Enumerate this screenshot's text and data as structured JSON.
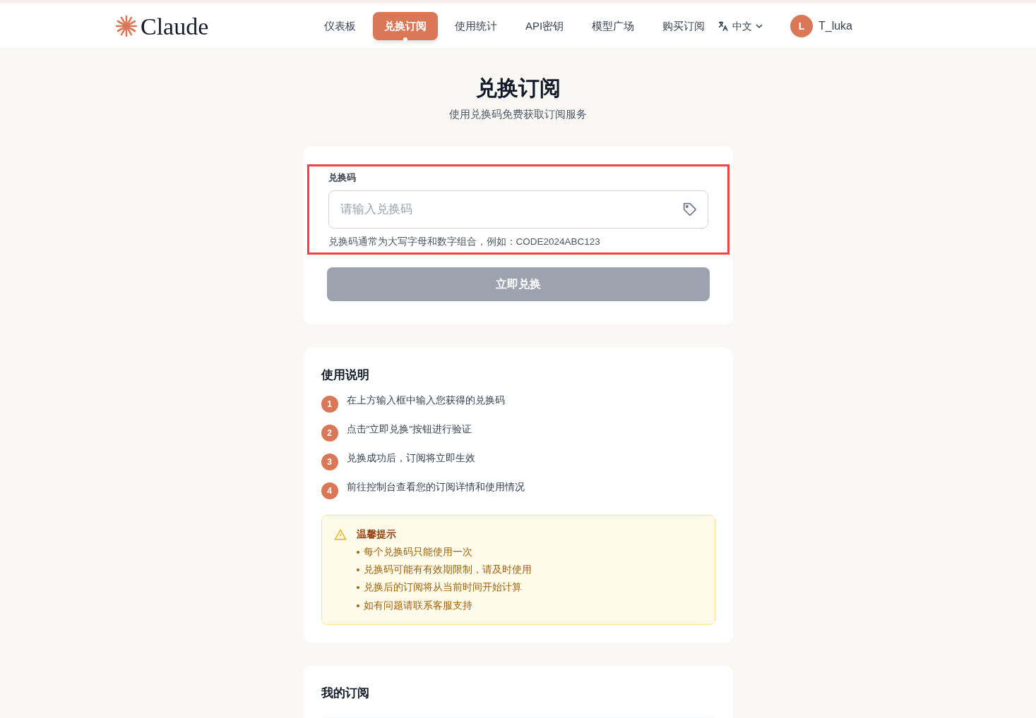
{
  "header": {
    "logo": "Claude",
    "nav": [
      {
        "label": "仪表板",
        "selected": false
      },
      {
        "label": "兑换订阅",
        "selected": true
      },
      {
        "label": "使用统计",
        "selected": false
      },
      {
        "label": "API密钥",
        "selected": false
      },
      {
        "label": "模型广场",
        "selected": false
      },
      {
        "label": "购买订阅",
        "selected": false
      }
    ],
    "language": "中文",
    "user": {
      "initial": "L",
      "name": "T_luka"
    }
  },
  "page": {
    "title": "兑换订阅",
    "subtitle": "使用兑换码免费获取订阅服务"
  },
  "redeem": {
    "label": "兑换码",
    "placeholder": "请输入兑换码",
    "hint": "兑换码通常为大写字母和数字组合，例如：CODE2024ABC123",
    "button": {
      "label": "立即兑换",
      "disabled": true
    }
  },
  "instructions": {
    "title": "使用说明",
    "steps": [
      {
        "number": "1",
        "text": "在上方输入框中输入您获得的兑换码"
      },
      {
        "number": "2",
        "text": "点击\"立即兑换\"按钮进行验证"
      },
      {
        "number": "3",
        "text": "兑换成功后，订阅将立即生效"
      },
      {
        "number": "4",
        "text": "前往控制台查看您的订阅详情和使用情况"
      }
    ],
    "notice": {
      "title": "温馨提示",
      "items": [
        "每个兑换码只能使用一次",
        "兑换码可能有有效期限制，请及时使用",
        "兑换后的订阅将从当前时间开始计算",
        "如有问题请联系客服支持"
      ]
    }
  },
  "subscriptions": {
    "title": "我的订阅"
  }
}
